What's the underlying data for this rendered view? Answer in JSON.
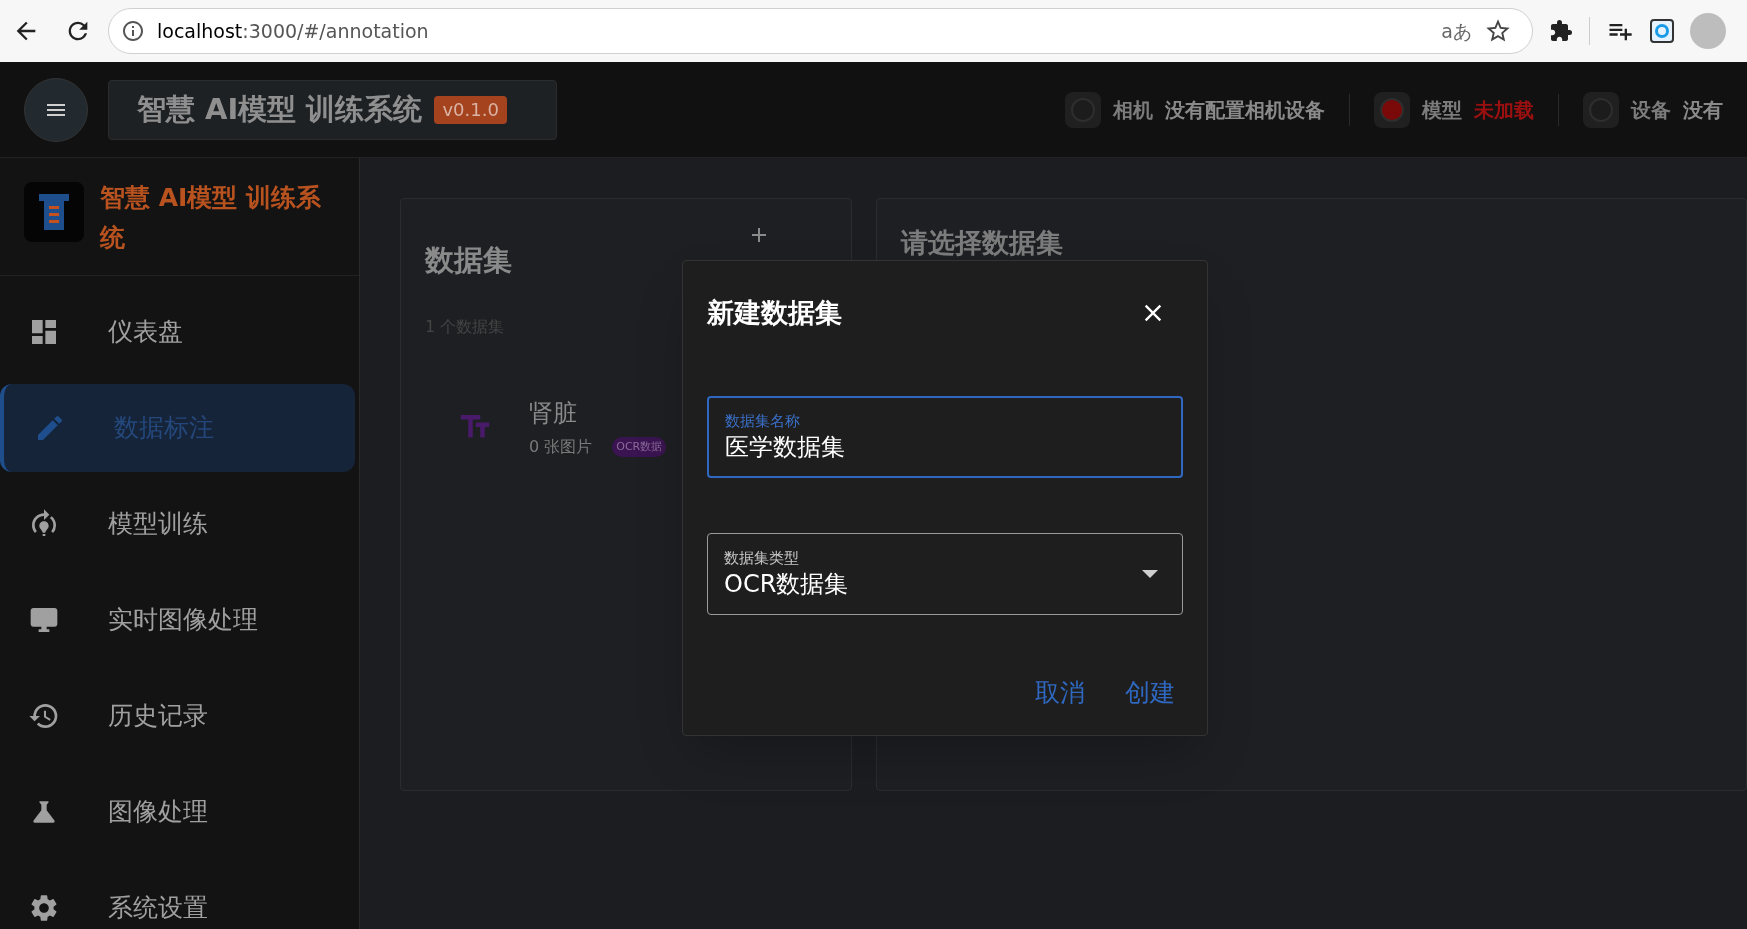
{
  "browser": {
    "url_host": "localhost",
    "url_path": ":3000/#/annotation",
    "translate_label": "aあ"
  },
  "header": {
    "title": "智慧 AI模型 训练系统",
    "version": "v0.1.0",
    "status": [
      {
        "label": "相机",
        "value": "没有配置相机设备",
        "alert": false
      },
      {
        "label": "模型",
        "value": "未加载",
        "alert": true
      },
      {
        "label": "设备",
        "value": "没有",
        "alert": false
      }
    ]
  },
  "sidebar": {
    "brand": "智慧 AI模型 训练系统",
    "items": [
      {
        "label": "仪表盘",
        "selected": false
      },
      {
        "label": "数据标注",
        "selected": true
      },
      {
        "label": "模型训练",
        "selected": false
      },
      {
        "label": "实时图像处理",
        "selected": false
      },
      {
        "label": "历史记录",
        "selected": false
      },
      {
        "label": "图像处理",
        "selected": false
      },
      {
        "label": "系统设置",
        "selected": false
      }
    ]
  },
  "datasets_panel": {
    "title": "数据集",
    "count": "1 个数据集",
    "items": [
      {
        "name": "肾脏",
        "images": "0 张图片",
        "type": "OCR数据"
      }
    ]
  },
  "detail_panel": {
    "title": "请选择数据集"
  },
  "dialog": {
    "title": "新建数据集",
    "name_field": {
      "label": "数据集名称",
      "value": "医学数据集",
      "focused": true
    },
    "type_field": {
      "label": "数据集类型",
      "value": "OCR数据集",
      "focused": false
    },
    "buttons": [
      "取消",
      "创建"
    ]
  }
}
